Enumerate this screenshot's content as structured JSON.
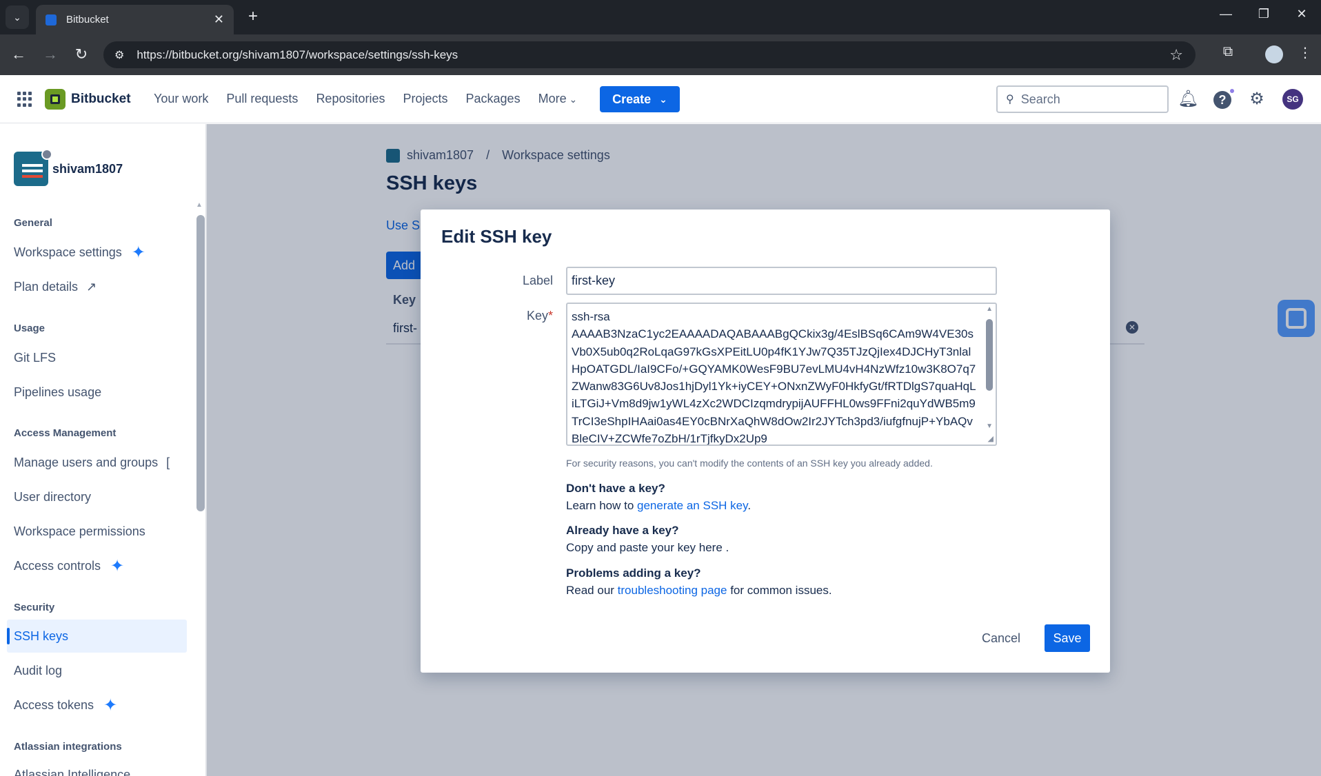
{
  "browser": {
    "tab_title": "Bitbucket",
    "url": "https://bitbucket.org/shivam1807/workspace/settings/ssh-keys"
  },
  "header": {
    "product": "Bitbucket",
    "nav": [
      "Your work",
      "Pull requests",
      "Repositories",
      "Projects",
      "Packages",
      "More"
    ],
    "create_label": "Create",
    "search_placeholder": "Search",
    "avatar_initials": "SG"
  },
  "sidebar": {
    "workspace_name": "shivam1807",
    "sections": {
      "general": "General",
      "usage": "Usage",
      "access_management": "Access Management",
      "security": "Security",
      "atlassian": "Atlassian integrations"
    },
    "items": {
      "workspace_settings": "Workspace settings",
      "plan_details": "Plan details",
      "git_lfs": "Git LFS",
      "pipelines_usage": "Pipelines usage",
      "manage_users": "Manage users and groups",
      "user_directory": "User directory",
      "workspace_permissions": "Workspace permissions",
      "access_controls": "Access controls",
      "ssh_keys": "SSH keys",
      "audit_log": "Audit log",
      "access_tokens": "Access tokens",
      "atlassian_intelligence": "Atlassian Intelligence"
    }
  },
  "page": {
    "breadcrumb_workspace": "shivam1807",
    "breadcrumb_separator": "/",
    "breadcrumb_settings": "Workspace settings",
    "title": "SSH keys",
    "use_link": "Use S",
    "add_button": "Add",
    "key_column": "Key",
    "key_row": "first-"
  },
  "modal": {
    "title": "Edit SSH key",
    "label_field_label": "Label",
    "label_value": "first-key",
    "key_field_label": "Key",
    "required_mark": "*",
    "key_value": "ssh-rsa\nAAAAB3NzaC1yc2EAAAADAQABAAABgQCkix3g/4EslBSq6CAm9W4VE30sVb0X5ub0q2RoLqaG97kGsXPEitLU0p4fK1YJw7Q35TJzQjIex4DJCHyT3nlalHpOATGDL/IaI9CFo/+GQYAMK0WesF9BU7evLMU4vH4NzWfz10w3K8O7q7ZWanw83G6Uv8Jos1hjDyl1Yk+iyCEY+ONxnZWyF0HkfyGt/fRTDlgS7quaHqLiLTGiJ+Vm8d9jw1yWL4zXc2WDCIzqmdrypijAUFFHL0ws9FFni2quYdWB5m9TrCI3eShpIHAai0as4EY0cBNrXaQhW8dOw2Ir2JYTch3pd3/iufgfnujP+YbAQvBleCIV+ZCWfe7oZbH/1rTjfkyDx2Up9",
    "hint": "For security reasons, you can't modify the contents of an SSH key you already added.",
    "no_key_heading": "Don't have a key?",
    "no_key_text": "Learn how to ",
    "no_key_link": "generate an SSH key",
    "no_key_end": ".",
    "have_key_heading": "Already have a key?",
    "have_key_text": "Copy and paste your key here .",
    "problems_heading": "Problems adding a key?",
    "problems_text": "Read our ",
    "problems_link": "troubleshooting page",
    "problems_end": " for common issues.",
    "cancel": "Cancel",
    "save": "Save"
  }
}
